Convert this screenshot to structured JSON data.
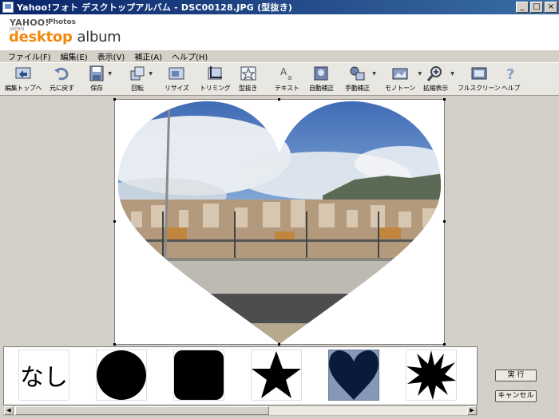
{
  "window": {
    "title": "Yahoo!フォト デスクトップアルバム - DSC00128.JPG (型抜き)",
    "minimize": "_",
    "maximize": "□",
    "close": "×"
  },
  "logo": {
    "yahoo": "YAHOO!",
    "yahoo_sub": "JAPAN",
    "photos": "Photos",
    "brand_1": "desktop",
    "brand_2": "album"
  },
  "menu": [
    "ファイル(F)",
    "編集(E)",
    "表示(V)",
    "補正(A)",
    "ヘルプ(H)"
  ],
  "toolbar": [
    {
      "label": "編集トップへ",
      "icon": "edit-top-icon"
    },
    {
      "label": "元に戻す",
      "icon": "undo-icon"
    },
    {
      "label": "保存",
      "icon": "save-icon"
    },
    {
      "label": "回転",
      "icon": "rotate-icon"
    },
    {
      "label": "リサイズ",
      "icon": "resize-icon"
    },
    {
      "label": "トリミング",
      "icon": "trim-icon"
    },
    {
      "label": "型抜き",
      "icon": "shape-cut-icon"
    },
    {
      "label": "テキスト",
      "icon": "text-icon"
    },
    {
      "label": "自動補正",
      "icon": "auto-correct-icon"
    },
    {
      "label": "手動補正",
      "icon": "manual-correct-icon"
    },
    {
      "label": "モノトーン",
      "icon": "monotone-icon"
    },
    {
      "label": "拡縮表示",
      "icon": "zoom-icon"
    },
    {
      "label": "フルスクリーン",
      "icon": "fullscreen-icon"
    },
    {
      "label": "ヘルプ",
      "icon": "help-icon"
    }
  ],
  "shapes": [
    {
      "label": "なし",
      "name": "none"
    },
    {
      "name": "circle"
    },
    {
      "name": "rounded-square"
    },
    {
      "name": "star"
    },
    {
      "name": "heart",
      "selected": true
    },
    {
      "name": "burst"
    }
  ],
  "buttons": {
    "execute": "実 行",
    "cancel": "キャンセル"
  },
  "colors": {
    "title_bar_start": "#0a246a",
    "title_bar_end": "#3a6ea5",
    "brand_orange": "#f08a10",
    "selected_shape_bg": "#8797b7",
    "heart_fill": "#0a1a3a"
  }
}
